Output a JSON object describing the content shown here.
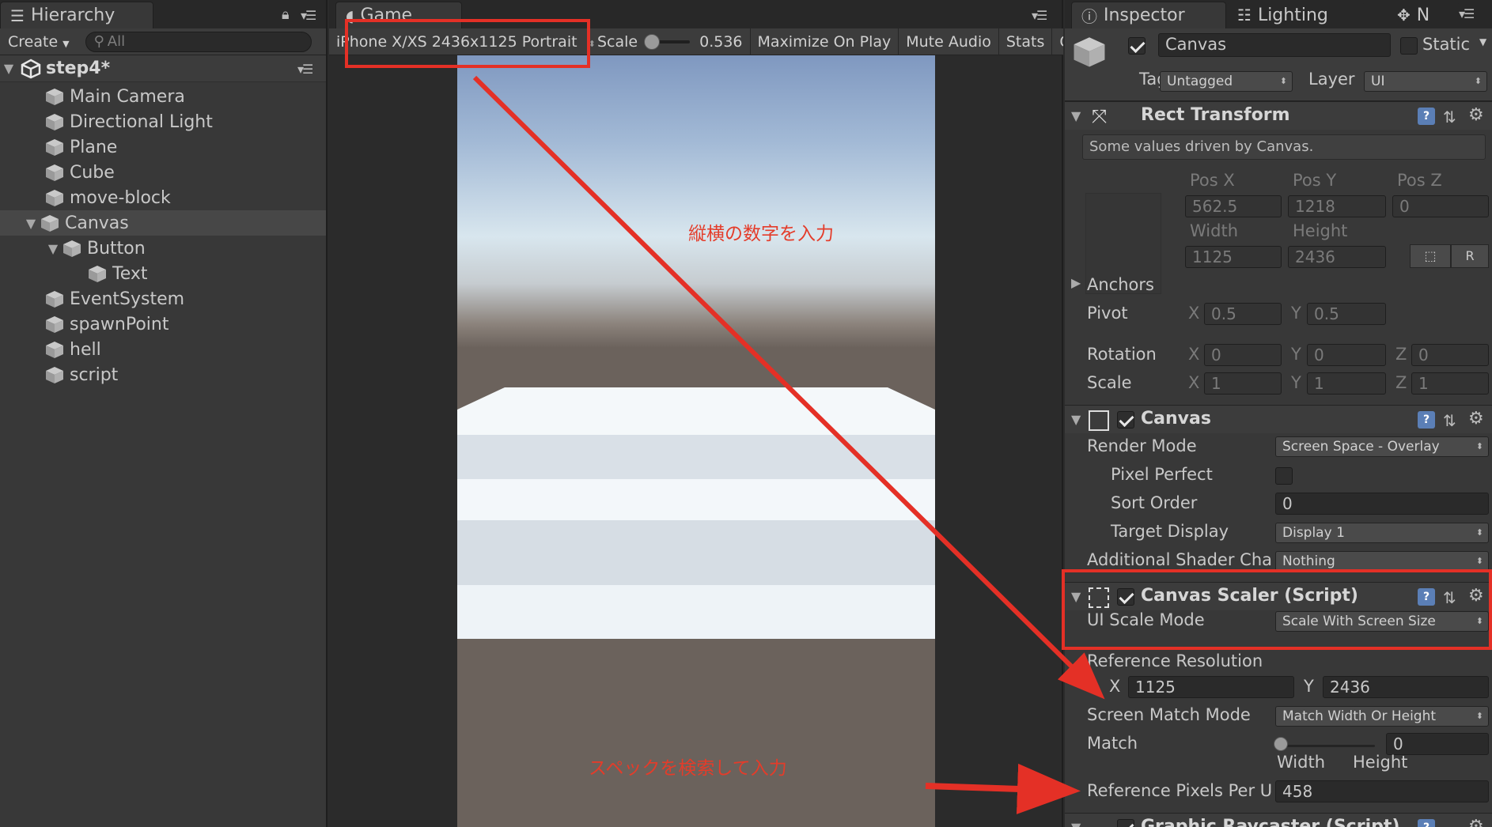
{
  "hierarchy": {
    "tab_label": "Hierarchy",
    "create_label": "Create",
    "search_placeholder": "All",
    "scene_name": "step4*",
    "items": [
      {
        "label": "Main Camera"
      },
      {
        "label": "Directional Light"
      },
      {
        "label": "Plane"
      },
      {
        "label": "Cube"
      },
      {
        "label": "move-block"
      },
      {
        "label": "Canvas"
      },
      {
        "label": "Button"
      },
      {
        "label": "Text"
      },
      {
        "label": "EventSystem"
      },
      {
        "label": "spawnPoint"
      },
      {
        "label": "hell"
      },
      {
        "label": "script"
      }
    ]
  },
  "game": {
    "tab_label": "Game",
    "resolution": "iPhone X/XS 2436x1125 Portrait",
    "scale_label": "Scale",
    "scale_value": "0.536",
    "maximize_label": "Maximize On Play",
    "mute_label": "Mute Audio",
    "stats_label": "Stats",
    "gizmos_label": "G"
  },
  "annotations": {
    "note_top": "縦横の数字を入力",
    "note_bottom": "スペックを検索して入力"
  },
  "inspector": {
    "tab_label": "Inspector",
    "lighting_label": "Lighting",
    "nav_label": "N",
    "object_name": "Canvas",
    "static_label": "Static",
    "tag_label": "Tag",
    "tag_value": "Untagged",
    "layer_label": "Layer",
    "layer_value": "UI",
    "rect_transform": {
      "title": "Rect Transform",
      "info": "Some values driven by Canvas.",
      "pos_x_label": "Pos X",
      "pos_y_label": "Pos Y",
      "pos_z_label": "Pos Z",
      "pos_x": "562.5",
      "pos_y": "1218",
      "pos_z": "0",
      "width_label": "Width",
      "height_label": "Height",
      "width": "1125",
      "height": "2436",
      "raw_label": "R",
      "anchors_label": "Anchors",
      "pivot_label": "Pivot",
      "pivot_x": "0.5",
      "pivot_y": "0.5",
      "rotation_label": "Rotation",
      "rot_x": "0",
      "rot_y": "0",
      "rot_z": "0",
      "scale_label": "Scale",
      "scale_x": "1",
      "scale_y": "1",
      "scale_z": "1",
      "x": "X",
      "y": "Y",
      "z": "Z"
    },
    "canvas": {
      "title": "Canvas",
      "render_mode_label": "Render Mode",
      "render_mode": "Screen Space - Overlay",
      "pixel_perfect_label": "Pixel Perfect",
      "sort_order_label": "Sort Order",
      "sort_order": "0",
      "target_display_label": "Target Display",
      "target_display": "Display 1",
      "shader_channels_label": "Additional Shader Cha",
      "shader_channels": "Nothing"
    },
    "canvas_scaler": {
      "title": "Canvas Scaler (Script)",
      "ui_scale_mode_label": "UI Scale Mode",
      "ui_scale_mode": "Scale With Screen Size",
      "ref_res_label": "Reference Resolution",
      "ref_x": "1125",
      "ref_y": "2436",
      "screen_match_label": "Screen Match Mode",
      "screen_match": "Match Width Or Height",
      "match_label": "Match",
      "match_value": "0",
      "width_label": "Width",
      "height_label": "Height",
      "ref_ppu_label": "Reference Pixels Per U",
      "ref_ppu": "458"
    },
    "graphic_raycaster": {
      "title": "Graphic Raycaster (Script)"
    }
  },
  "colors": {
    "annotation_red": "#e43026",
    "panel_bg": "#383838",
    "selected_row": "#474747"
  }
}
